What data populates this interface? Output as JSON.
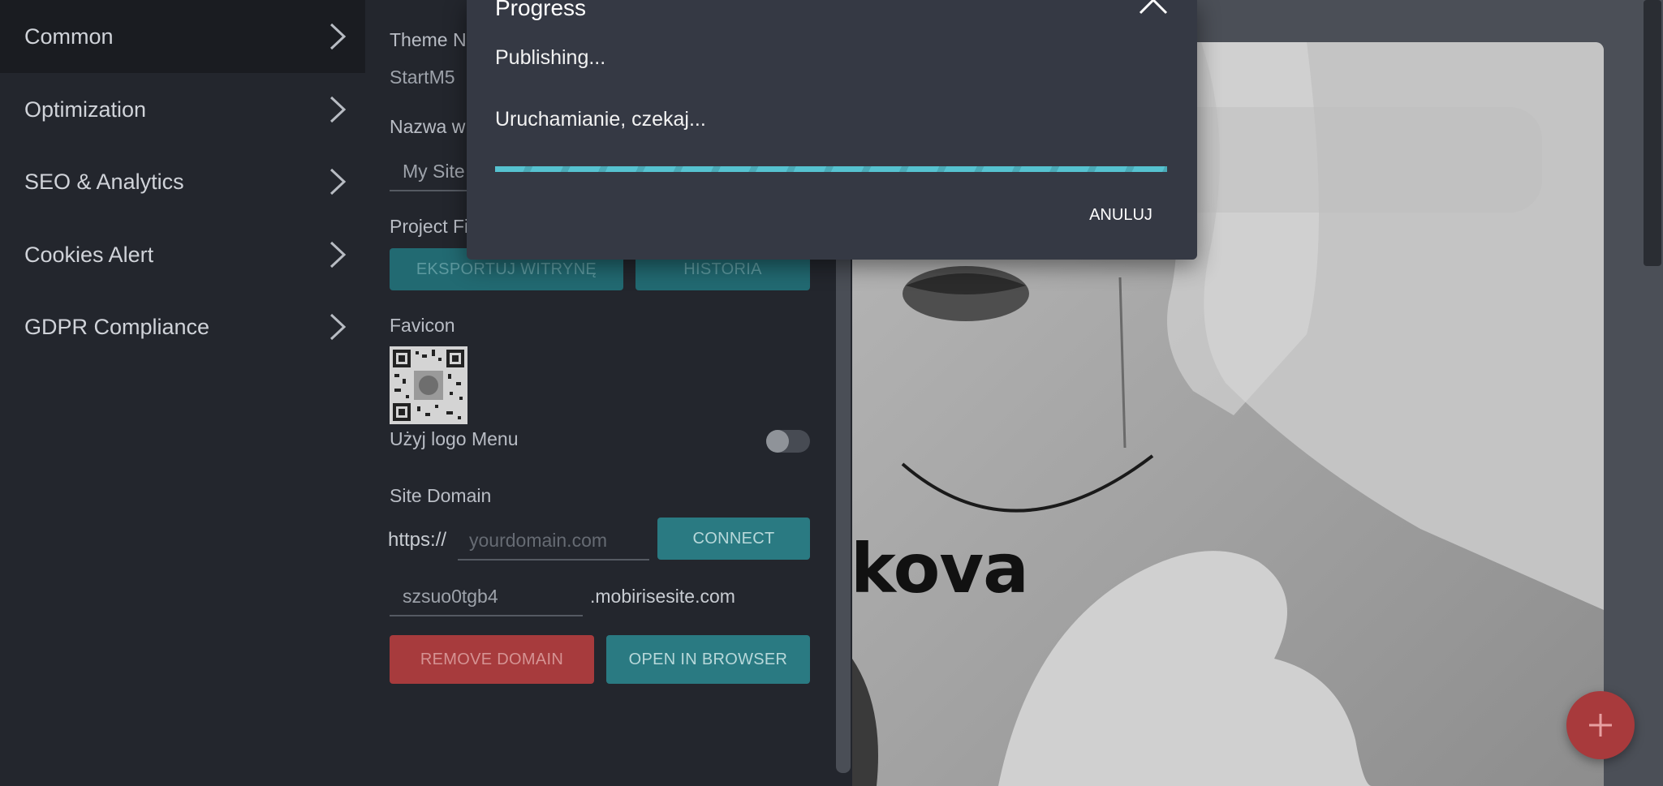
{
  "nav": {
    "items": [
      {
        "label": "Common",
        "active": true
      },
      {
        "label": "Optimization",
        "active": false
      },
      {
        "label": "SEO & Analytics",
        "active": false
      },
      {
        "label": "Cookies Alert",
        "active": false
      },
      {
        "label": "GDPR Compliance",
        "active": false
      }
    ]
  },
  "panel": {
    "theme_label": "Theme Na",
    "theme_value": "StartM5",
    "site_name_label": "Nazwa w",
    "site_name_value": "My Site",
    "project_files_label": "Project Fi",
    "export_button": "EKSPORTUJ WITRYNĘ",
    "history_button": "HISTORIA",
    "favicon_label": "Favicon",
    "use_logo_label": "Użyj logo Menu",
    "use_logo_on": false,
    "site_domain_label": "Site Domain",
    "https_prefix": "https://",
    "domain_placeholder": "yourdomain.com",
    "connect_button": "CONNECT",
    "subdomain_value": "szsuo0tgb4",
    "subdomain_suffix": ".mobirisesite.com",
    "remove_domain_button": "REMOVE DOMAIN",
    "open_browser_button": "OPEN IN BROWSER"
  },
  "preview": {
    "title_fragment": "kova"
  },
  "dialog": {
    "title": "Progress",
    "message": "Publishing...",
    "status": "Uruchamianie, czekaj...",
    "progress": 1.0,
    "cancel_label": "ANULUJ"
  },
  "colors": {
    "accent": "#2a7a82",
    "danger": "#a73b3d",
    "progress": "#56c2d0"
  }
}
